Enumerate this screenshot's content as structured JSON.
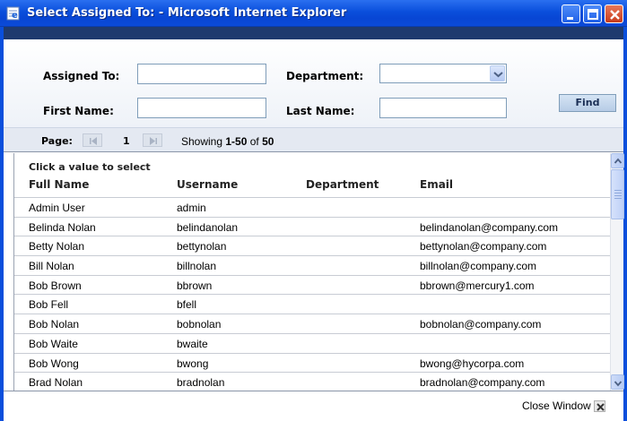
{
  "window": {
    "title": "Select Assigned To: - Microsoft Internet Explorer",
    "accent": "#0a4fdc"
  },
  "filters": {
    "assigned_to_label": "Assigned To:",
    "assigned_to_value": "",
    "department_label": "Department:",
    "department_value": "",
    "first_name_label": "First Name:",
    "first_name_value": "",
    "last_name_label": "Last Name:",
    "last_name_value": "",
    "find_label": "Find"
  },
  "pager": {
    "page_label": "Page:",
    "page_number": "1",
    "showing_prefix": "Showing ",
    "showing_range": "1-50",
    "showing_suffix": " of ",
    "showing_total": "50"
  },
  "list": {
    "hint": "Click a value to select",
    "columns": [
      "Full Name",
      "Username",
      "Department",
      "Email"
    ],
    "rows": [
      {
        "full_name": "Admin User",
        "username": "admin",
        "department": "",
        "email": ""
      },
      {
        "full_name": "Belinda Nolan",
        "username": "belindanolan",
        "department": "",
        "email": "belindanolan@company.com"
      },
      {
        "full_name": "Betty Nolan",
        "username": "bettynolan",
        "department": "",
        "email": "bettynolan@company.com"
      },
      {
        "full_name": "Bill Nolan",
        "username": "billnolan",
        "department": "",
        "email": "billnolan@company.com"
      },
      {
        "full_name": "Bob Brown",
        "username": "bbrown",
        "department": "",
        "email": "bbrown@mercury1.com"
      },
      {
        "full_name": "Bob Fell",
        "username": "bfell",
        "department": "",
        "email": ""
      },
      {
        "full_name": "Bob Nolan",
        "username": "bobnolan",
        "department": "",
        "email": "bobnolan@company.com"
      },
      {
        "full_name": "Bob Waite",
        "username": "bwaite",
        "department": "",
        "email": ""
      },
      {
        "full_name": "Bob Wong",
        "username": "bwong",
        "department": "",
        "email": "bwong@hycorpa.com"
      },
      {
        "full_name": "Brad Nolan",
        "username": "bradnolan",
        "department": "",
        "email": "bradnolan@company.com"
      }
    ]
  },
  "footer": {
    "close_window_label": "Close Window"
  }
}
